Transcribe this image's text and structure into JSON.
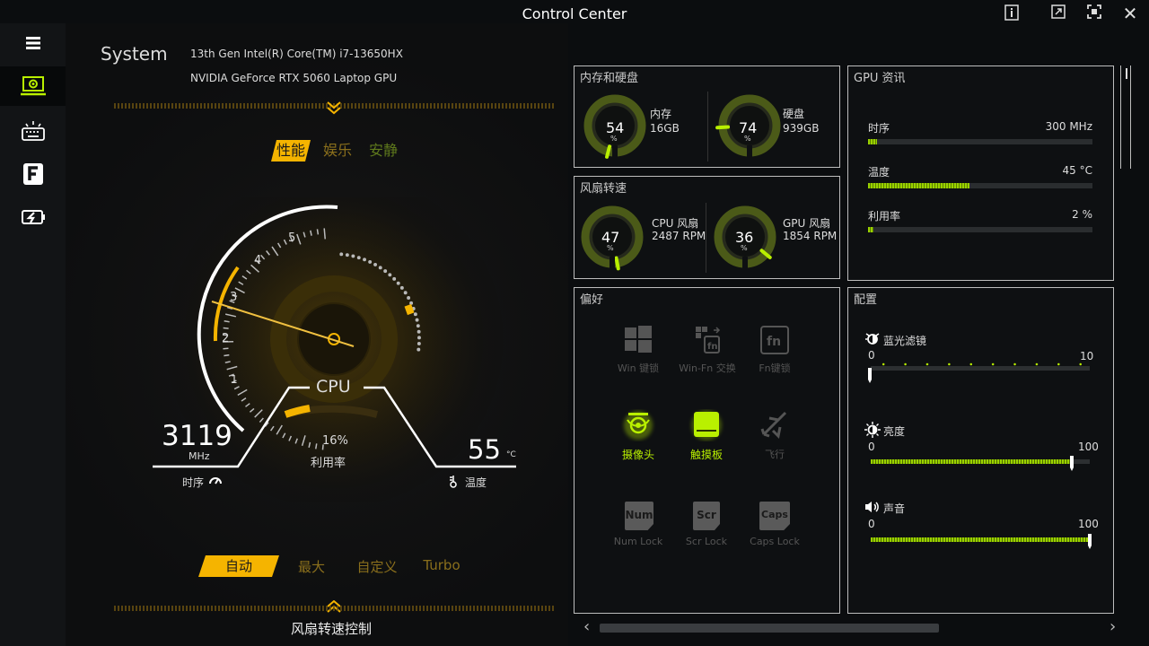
{
  "window": {
    "title": "Control Center"
  },
  "sidebar": {
    "items": [
      {
        "name": "menu"
      },
      {
        "name": "system"
      },
      {
        "name": "keyboard"
      },
      {
        "name": "f-key"
      },
      {
        "name": "battery"
      }
    ]
  },
  "system": {
    "label": "System",
    "cpu": "13th Gen Intel(R) Core(TM) i7-13650HX",
    "gpu": "NVIDIA GeForce RTX 5060 Laptop GPU"
  },
  "modes": {
    "tabs": [
      "性能",
      "娱乐",
      "安静"
    ],
    "active": 0
  },
  "cpu_gauge": {
    "label": "CPU",
    "scale": [
      "1",
      "2",
      "3",
      "4",
      "5"
    ],
    "clock_value": "3119",
    "clock_unit": "MHz",
    "clock_label": "时序",
    "usage_value": "16%",
    "usage_label": "利用率",
    "temp_value": "55",
    "temp_unit": "°C",
    "temp_label": "温度",
    "usage_fraction": 0.16
  },
  "fan_modes": {
    "tabs": [
      "自动",
      "最大",
      "自定义",
      "Turbo"
    ],
    "active": 0
  },
  "fan_control_label": "风扇转速控制",
  "memory": {
    "title": "内存和硬盘",
    "ram": {
      "value": "54",
      "unit": "%",
      "label": "内存",
      "detail": "16GB",
      "fraction": 0.54
    },
    "disk": {
      "value": "74",
      "unit": "%",
      "label": "硬盘",
      "detail": "939GB",
      "fraction": 0.74
    }
  },
  "fans": {
    "title": "风扇转速",
    "cpu": {
      "value": "47",
      "unit": "%",
      "label": "CPU 风扇",
      "detail": "2487 RPM",
      "fraction": 0.47
    },
    "gpu": {
      "value": "36",
      "unit": "%",
      "label": "GPU 风扇",
      "detail": "1854 RPM",
      "fraction": 0.36
    }
  },
  "gpu_info": {
    "title": "GPU 资讯",
    "rows": [
      {
        "label": "时序",
        "value": "300 MHz",
        "fraction": 0.04
      },
      {
        "label": "温度",
        "value": "45 °C",
        "fraction": 0.45
      },
      {
        "label": "利用率",
        "value": "2 %",
        "fraction": 0.02
      }
    ]
  },
  "preferences": {
    "title": "偏好",
    "items": [
      {
        "label": "Win 键锁",
        "on": false
      },
      {
        "label": "Win-Fn 交换",
        "on": false
      },
      {
        "label": "Fn键锁",
        "on": false
      },
      {
        "label": "摄像头",
        "on": true
      },
      {
        "label": "触摸板",
        "on": true
      },
      {
        "label": "飞行",
        "on": false
      },
      {
        "label": "Num Lock",
        "icon_text": "Num",
        "on": false
      },
      {
        "label": "Scr Lock",
        "icon_text": "Scr",
        "on": false
      },
      {
        "label": "Caps Lock",
        "icon_text": "Caps",
        "on": false
      }
    ]
  },
  "config": {
    "title": "配置",
    "sliders": [
      {
        "label": "蓝光滤镜",
        "min": "0",
        "max": "10",
        "value": 0
      },
      {
        "label": "亮度",
        "min": "0",
        "max": "100",
        "value": 0.92
      },
      {
        "label": "声音",
        "min": "0",
        "max": "100",
        "value": 1.0
      }
    ]
  },
  "colors": {
    "accent": "#f5b400",
    "green": "#9ad200",
    "panel_border": "#bdbdbd"
  }
}
